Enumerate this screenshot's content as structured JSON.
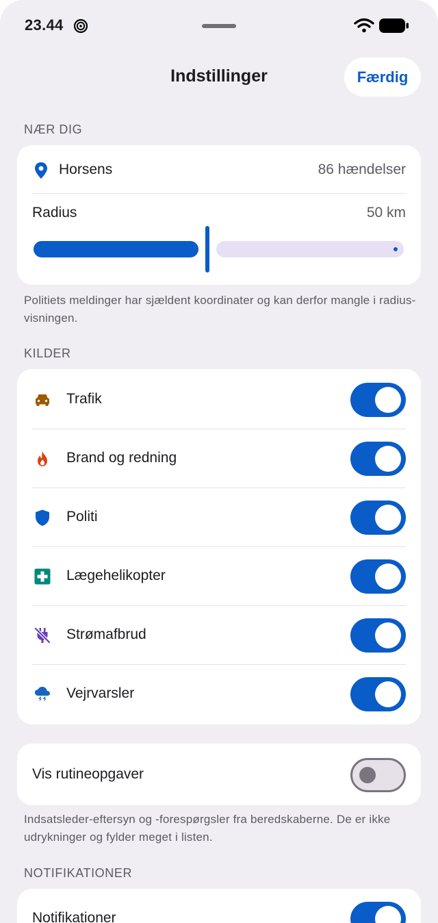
{
  "status_bar": {
    "time": "23.44"
  },
  "header": {
    "title": "Indstillinger",
    "done_label": "Færdig"
  },
  "near_you": {
    "section_title": "NÆR DIG",
    "location_name": "Horsens",
    "event_count": "86 hændelser",
    "radius_label": "Radius",
    "radius_value": "50 km",
    "radius_fraction": 0.47,
    "footnote": "Politiets meldinger har sjældent koordinater og kan derfor mangle i radius-visningen."
  },
  "sources": {
    "section_title": "KILDER",
    "items": [
      {
        "label": "Trafik",
        "icon": "car-icon",
        "color": "#9a5b00",
        "enabled": true
      },
      {
        "label": "Brand og redning",
        "icon": "fire-icon",
        "color": "#d84315",
        "enabled": true
      },
      {
        "label": "Politi",
        "icon": "shield-icon",
        "color": "#0a5cc8",
        "enabled": true
      },
      {
        "label": "Lægehelikopter",
        "icon": "medical-cross-icon",
        "color": "#00897b",
        "enabled": true
      },
      {
        "label": "Strømafbrud",
        "icon": "power-off-icon",
        "color": "#6a3fb5",
        "enabled": true
      },
      {
        "label": "Vejrvarsler",
        "icon": "storm-cloud-icon",
        "color": "#1565c0",
        "enabled": true
      }
    ]
  },
  "routine": {
    "label": "Vis rutineopgaver",
    "enabled": false,
    "footnote": "Indsatsleder-eftersyn og -forespørgsler fra beredskaberne. De er ikke udrykninger og fylder meget i listen."
  },
  "notifications": {
    "section_title": "NOTIFIKATIONER",
    "label": "Notifikationer",
    "enabled": true
  },
  "colors": {
    "accent": "#0a5cc8",
    "background": "#f0eef3",
    "card": "#ffffff"
  }
}
